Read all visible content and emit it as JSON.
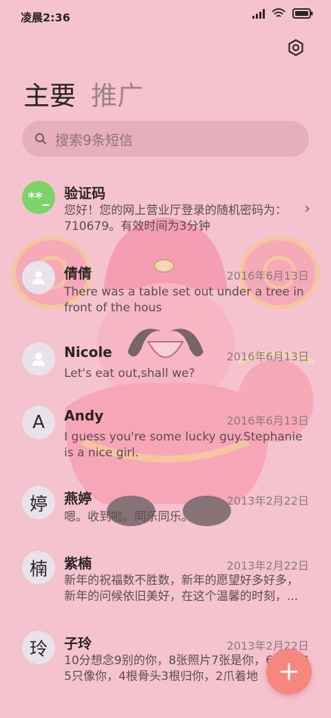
{
  "status_bar": {
    "time": "凌晨2:36",
    "icons": [
      "signal-icon",
      "wifi-icon",
      "battery-icon"
    ]
  },
  "header": {
    "settings_icon": "settings-icon"
  },
  "tabs": [
    {
      "label": "主要",
      "active": true
    },
    {
      "label": "推广",
      "active": false
    }
  ],
  "search": {
    "placeholder": "搜索9条短信",
    "icon": "search-icon"
  },
  "conversations": [
    {
      "name": "验证码",
      "avatar": "**_",
      "date": "",
      "preview": "您好！您的网上营业厅登录的随机密码为：710679。有效时间为3分钟",
      "chevron": "›"
    },
    {
      "name": "倩倩",
      "avatar": "",
      "date": "2016年6月13日",
      "preview": "There was a table set out under a tree in front of the hous"
    },
    {
      "name": "Nicole",
      "avatar": "",
      "date": "2016年6月13日",
      "preview": "Let's eat out,shall we?"
    },
    {
      "name": "Andy",
      "avatar": "A",
      "date": "2016年6月13日",
      "preview": "I guess you're some lucky guy.Stephanie is a nice girl."
    },
    {
      "name": "燕婷",
      "avatar": "婷",
      "date": "2013年2月22日",
      "preview": "嗯。收到啦。同乐同乐。"
    },
    {
      "name": "紫楠",
      "avatar": "楠",
      "date": "2013年2月22日",
      "preview": "新年的祝福数不胜数，新年的愿望好多好多，新年的问候依旧美好，在这个温馨的时刻，..."
    },
    {
      "name": "子玲",
      "avatar": "玲",
      "date": "2013年2月22日",
      "preview": "10分想念9别的你，8张照片7张是你，6只小狗5只像你，4根骨头3根归你，2爪着地"
    }
  ],
  "fab": {
    "icon": "plus-icon",
    "symbol": "+"
  },
  "colors": {
    "background": "#f5c3cf",
    "fab": "#f58680",
    "green_avatar": "#7dd36a"
  }
}
